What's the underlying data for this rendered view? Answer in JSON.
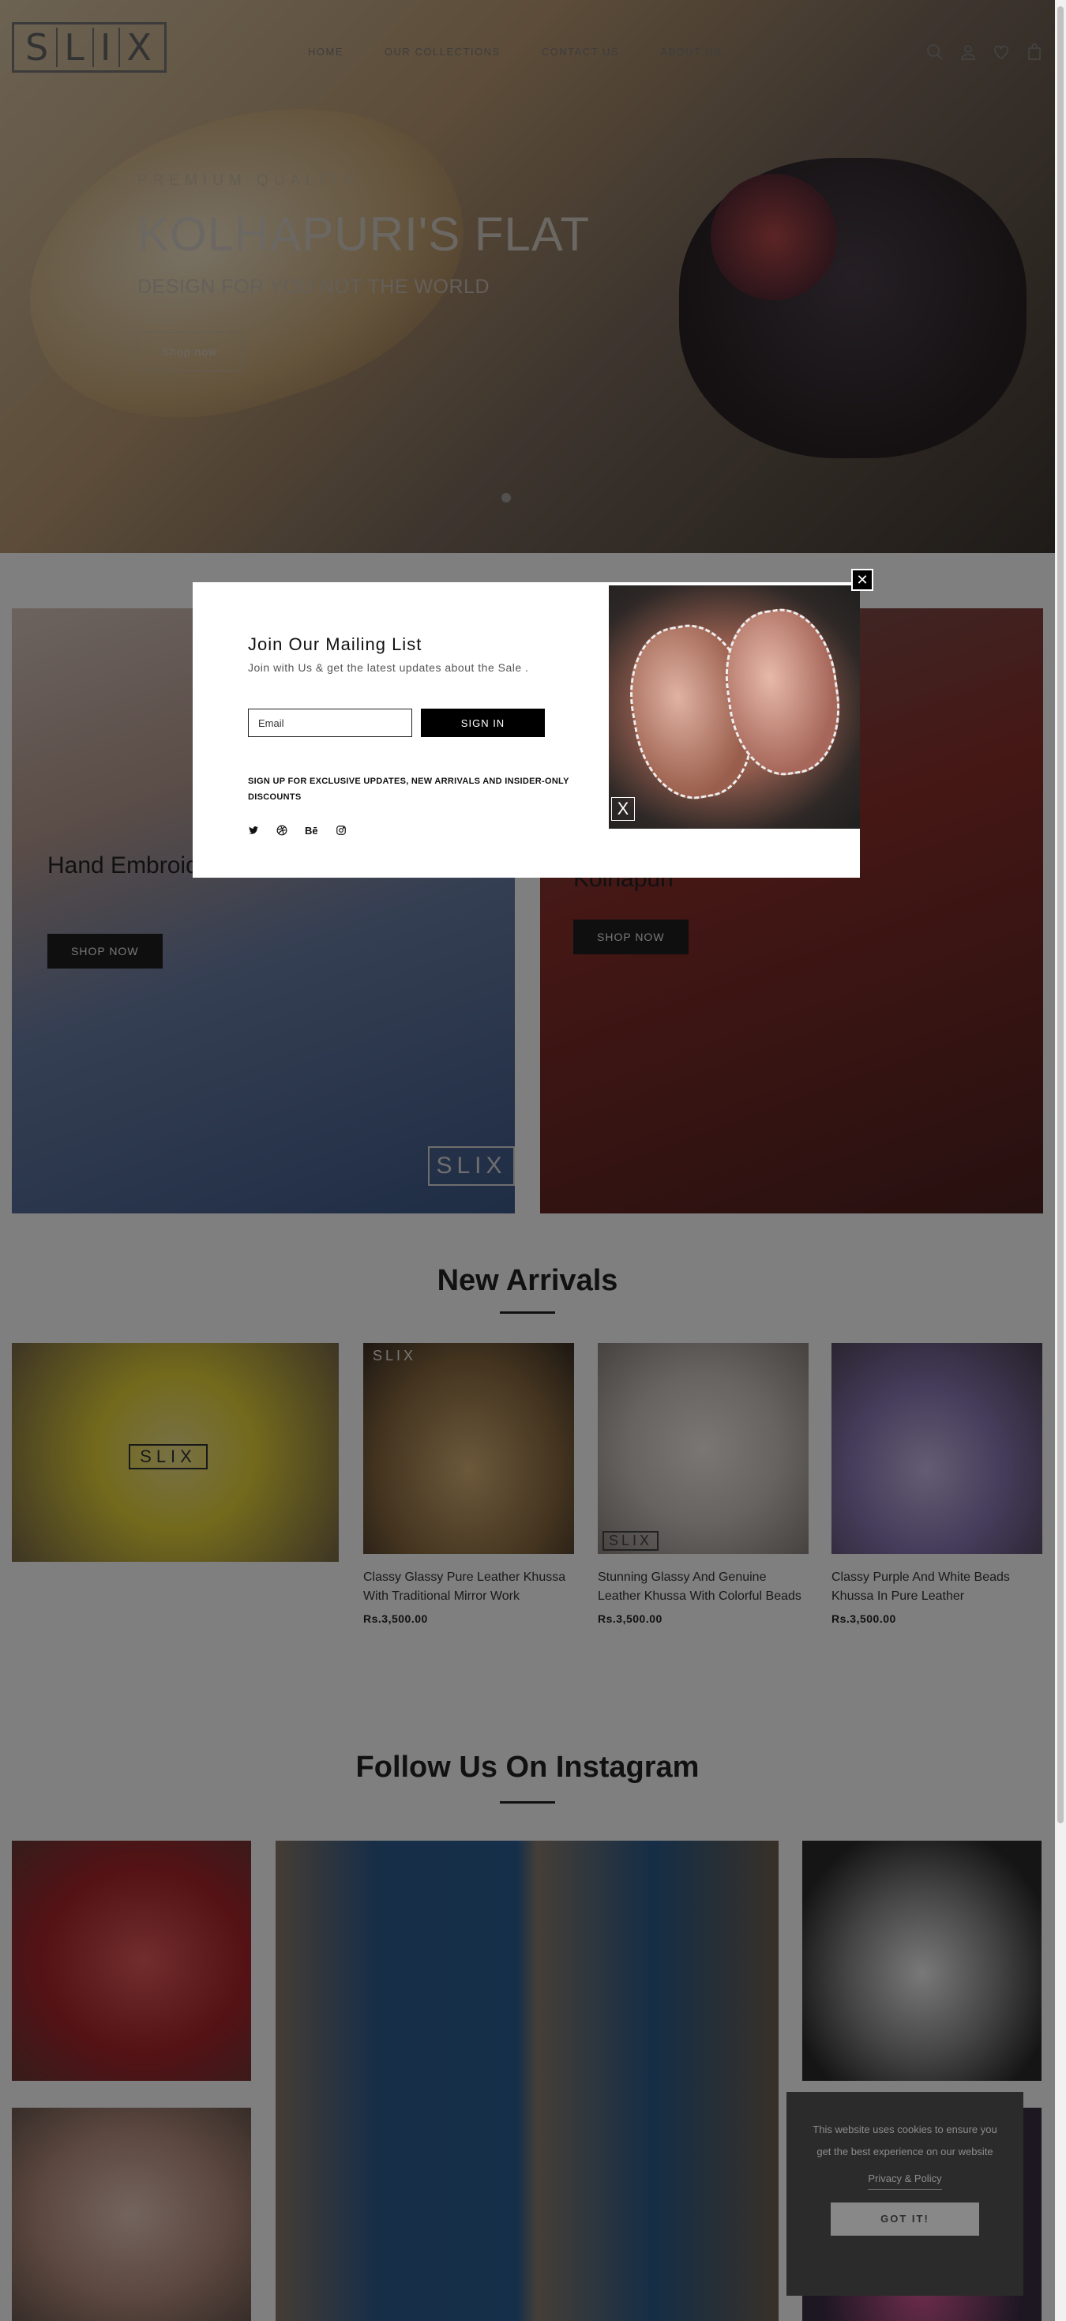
{
  "header": {
    "logo_text": "SLIX",
    "nav": [
      "HOME",
      "OUR COLLECTIONS",
      "CONTACT US",
      "ABOUT US"
    ]
  },
  "hero": {
    "kicker": "PREMIUM QUALITY",
    "title": "KOLHAPURI'S FLAT",
    "subtitle": "DESIGN FOR YOU NOT THE WORLD",
    "button": "Shop now"
  },
  "banners": {
    "left": {
      "title": "Hand Embroidered Khussa",
      "button": "SHOP NOW",
      "watermark": "SLIX"
    },
    "right": {
      "title": "Kolhapuri",
      "button": "SHOP NOW"
    }
  },
  "new_arrivals": {
    "title": "New Arrivals",
    "feature_watermark": "SLIX",
    "products": [
      {
        "name": "Classy Glassy Pure Leather Khussa With Traditional Mirror Work",
        "price": "Rs.3,500.00",
        "watermark": "SLIX"
      },
      {
        "name": "Stunning Glassy And Genuine Leather Khussa With Colorful Beads",
        "price": "Rs.3,500.00",
        "watermark": "SLIX"
      },
      {
        "name": "Classy Purple And White Beads Khussa In Pure Leather",
        "price": "Rs.3,500.00"
      }
    ]
  },
  "instagram": {
    "title": "Follow Us On Instagram"
  },
  "modal": {
    "title": "Join Our Mailing List",
    "subtitle": "Join with Us & get the latest updates about the Sale .",
    "email_placeholder": "Email",
    "button": "SIGN IN",
    "fine_print": "SIGN UP FOR EXCLUSIVE UPDATES, NEW ARRIVALS AND INSIDER-ONLY DISCOUNTS",
    "social": [
      "twitter-icon",
      "dribbble-icon",
      "behance-icon",
      "instagram-icon"
    ],
    "image_close": "X"
  },
  "cookie": {
    "text": "This website uses cookies to ensure you get the best experience on our website",
    "link": "Privacy & Policy",
    "button": "GOT IT!"
  }
}
